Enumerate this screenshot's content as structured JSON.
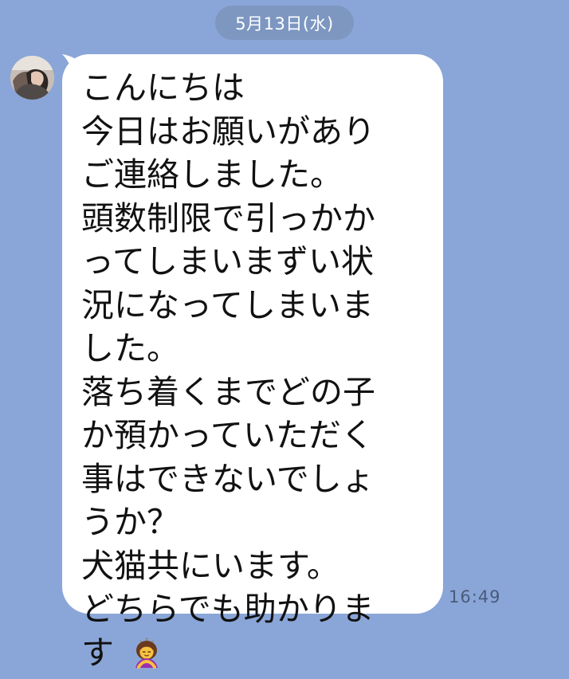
{
  "chat": {
    "date_label": "5月13日(水)",
    "message": {
      "lines": [
        "こんにちは",
        "今日はお願いがあり",
        "ご連絡しました。",
        "頭数制限で引っかか",
        "ってしまいまずい状",
        "況になってしまいま",
        "した。",
        "落ち着くまでどの子",
        "か預かっていただく",
        "事はできないでしょ",
        "うか？",
        "犬猫共にいます。",
        "どちらでも助かりま",
        "す"
      ],
      "emoji_name": "person-bowing-icon",
      "timestamp": "16:49"
    }
  },
  "colors": {
    "background": "#8aa6d8",
    "bubble": "#ffffff",
    "date_pill": "#6f80a1",
    "timestamp": "#495b7b"
  }
}
